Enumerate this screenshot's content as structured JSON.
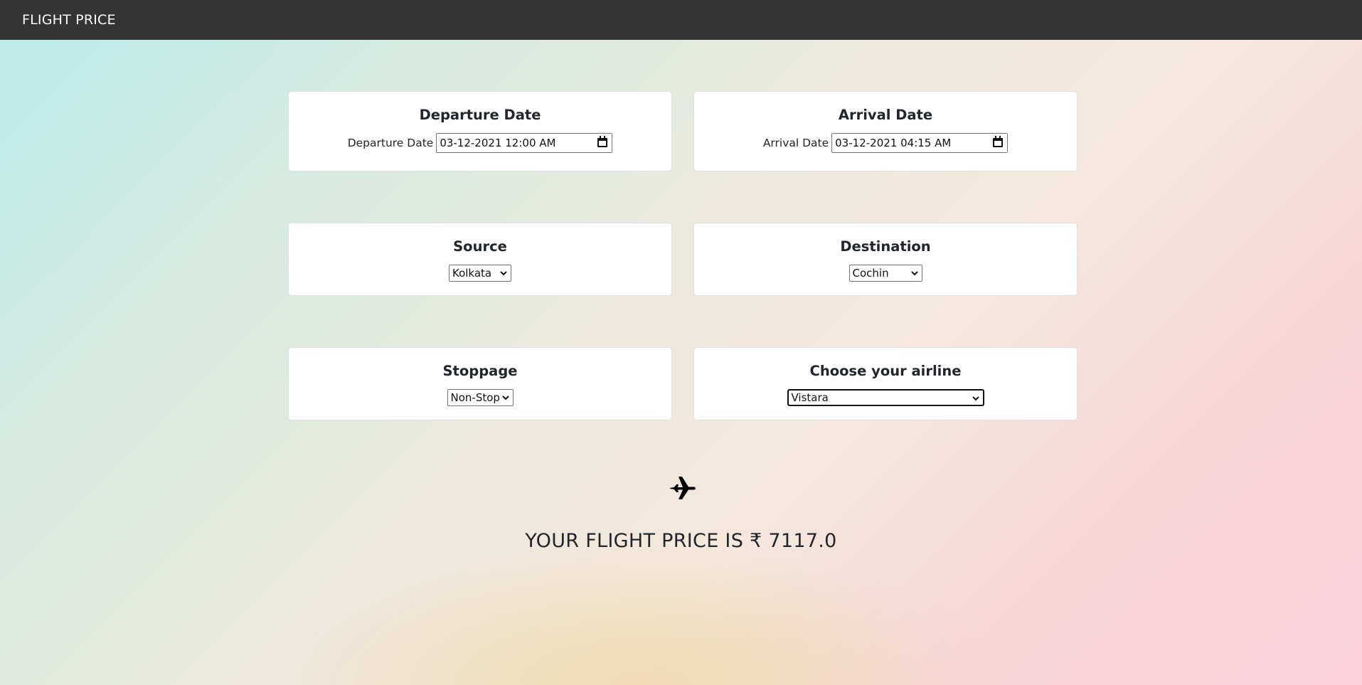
{
  "navbar": {
    "brand": "FLIGHT PRICE"
  },
  "departure": {
    "title": "Departure Date",
    "label": "Departure Date",
    "value": "03-12-2021 12:00 AM"
  },
  "arrival": {
    "title": "Arrival Date",
    "label": "Arrival Date",
    "value": "03-12-2021 04:15 AM"
  },
  "source": {
    "title": "Source",
    "selected": "Kolkata"
  },
  "destination": {
    "title": "Destination",
    "selected": "Cochin"
  },
  "stoppage": {
    "title": "Stoppage",
    "selected": "Non-Stop"
  },
  "airline": {
    "title": "Choose your airline",
    "selected": "Vistara"
  },
  "result": {
    "icon": "airplane-icon",
    "text": "YOUR FLIGHT PRICE IS ₹ 7117.0"
  },
  "colors": {
    "navbar": "#343434",
    "card": "#ffffff",
    "text": "#222529"
  }
}
